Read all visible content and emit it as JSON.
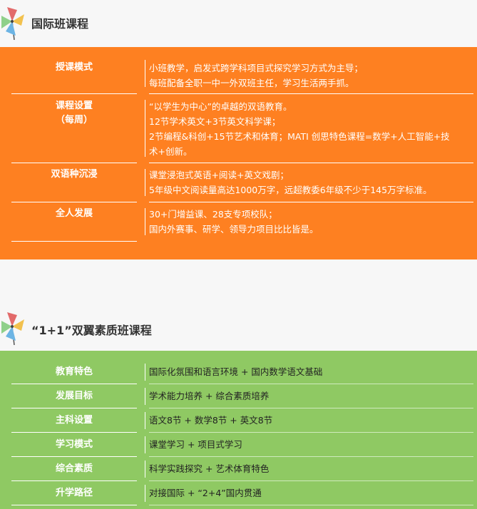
{
  "section1": {
    "title": "国际班课程",
    "rows": [
      {
        "label": "授课模式",
        "lines": [
          "小班教学，启发式跨学科项目式探究学习方式为主导；",
          "每班配备全职一中一外双班主任，学习生活两手抓。"
        ]
      },
      {
        "label": "课程设置",
        "label2": "（每周）",
        "lines": [
          "“以学生为中心”的卓越的双语教育。",
          "12节学术英文+3节英文科学课；",
          "2节编程&科创+15节艺术和体育；MATI 创思特色课程=数学+人工智能+技",
          "术+创新。"
        ]
      },
      {
        "label": "双语种沉浸",
        "lines": [
          "课堂浸泡式英语+阅读+英文戏剧；",
          "5年级中文阅读量高达1000万字，远超教委6年级不少于145万字标准。"
        ]
      },
      {
        "label": "全人发展",
        "lines": [
          "30+门增益课、28支专项校队；",
          "国内外赛事、研学、领导力项目比比皆是。"
        ]
      }
    ]
  },
  "section2": {
    "title": "“1+1”双翼素质班课程",
    "rows": [
      {
        "label": "教育特色",
        "text": "国际化氛围和语言环境 + 国内数学语文基础"
      },
      {
        "label": "发展目标",
        "text": "学术能力培养 + 综合素质培养"
      },
      {
        "label": "主科设置",
        "text": "语文8节 + 数学8节 + 英文8节"
      },
      {
        "label": "学习模式",
        "text": "课堂学习 + 项目式学习"
      },
      {
        "label": "综合素质",
        "text": "科学实践探究 + 艺术体育特色"
      },
      {
        "label": "升学路径",
        "text": "对接国际 + “2+4”国内贯通"
      }
    ]
  },
  "colors": {
    "orange": "#fe8021",
    "green": "#8fc963"
  },
  "icons": {
    "header": "pinwheel-icon"
  }
}
